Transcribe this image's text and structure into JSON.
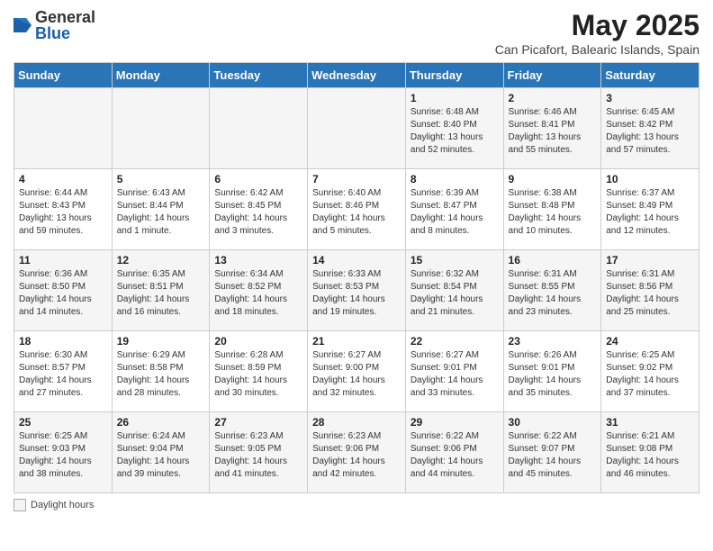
{
  "header": {
    "logo_general": "General",
    "logo_blue": "Blue",
    "main_title": "May 2025",
    "subtitle": "Can Picafort, Balearic Islands, Spain"
  },
  "days_of_week": [
    "Sunday",
    "Monday",
    "Tuesday",
    "Wednesday",
    "Thursday",
    "Friday",
    "Saturday"
  ],
  "weeks": [
    [
      {
        "day": "",
        "info": ""
      },
      {
        "day": "",
        "info": ""
      },
      {
        "day": "",
        "info": ""
      },
      {
        "day": "",
        "info": ""
      },
      {
        "day": "1",
        "info": "Sunrise: 6:48 AM\nSunset: 8:40 PM\nDaylight: 13 hours\nand 52 minutes."
      },
      {
        "day": "2",
        "info": "Sunrise: 6:46 AM\nSunset: 8:41 PM\nDaylight: 13 hours\nand 55 minutes."
      },
      {
        "day": "3",
        "info": "Sunrise: 6:45 AM\nSunset: 8:42 PM\nDaylight: 13 hours\nand 57 minutes."
      }
    ],
    [
      {
        "day": "4",
        "info": "Sunrise: 6:44 AM\nSunset: 8:43 PM\nDaylight: 13 hours\nand 59 minutes."
      },
      {
        "day": "5",
        "info": "Sunrise: 6:43 AM\nSunset: 8:44 PM\nDaylight: 14 hours\nand 1 minute."
      },
      {
        "day": "6",
        "info": "Sunrise: 6:42 AM\nSunset: 8:45 PM\nDaylight: 14 hours\nand 3 minutes."
      },
      {
        "day": "7",
        "info": "Sunrise: 6:40 AM\nSunset: 8:46 PM\nDaylight: 14 hours\nand 5 minutes."
      },
      {
        "day": "8",
        "info": "Sunrise: 6:39 AM\nSunset: 8:47 PM\nDaylight: 14 hours\nand 8 minutes."
      },
      {
        "day": "9",
        "info": "Sunrise: 6:38 AM\nSunset: 8:48 PM\nDaylight: 14 hours\nand 10 minutes."
      },
      {
        "day": "10",
        "info": "Sunrise: 6:37 AM\nSunset: 8:49 PM\nDaylight: 14 hours\nand 12 minutes."
      }
    ],
    [
      {
        "day": "11",
        "info": "Sunrise: 6:36 AM\nSunset: 8:50 PM\nDaylight: 14 hours\nand 14 minutes."
      },
      {
        "day": "12",
        "info": "Sunrise: 6:35 AM\nSunset: 8:51 PM\nDaylight: 14 hours\nand 16 minutes."
      },
      {
        "day": "13",
        "info": "Sunrise: 6:34 AM\nSunset: 8:52 PM\nDaylight: 14 hours\nand 18 minutes."
      },
      {
        "day": "14",
        "info": "Sunrise: 6:33 AM\nSunset: 8:53 PM\nDaylight: 14 hours\nand 19 minutes."
      },
      {
        "day": "15",
        "info": "Sunrise: 6:32 AM\nSunset: 8:54 PM\nDaylight: 14 hours\nand 21 minutes."
      },
      {
        "day": "16",
        "info": "Sunrise: 6:31 AM\nSunset: 8:55 PM\nDaylight: 14 hours\nand 23 minutes."
      },
      {
        "day": "17",
        "info": "Sunrise: 6:31 AM\nSunset: 8:56 PM\nDaylight: 14 hours\nand 25 minutes."
      }
    ],
    [
      {
        "day": "18",
        "info": "Sunrise: 6:30 AM\nSunset: 8:57 PM\nDaylight: 14 hours\nand 27 minutes."
      },
      {
        "day": "19",
        "info": "Sunrise: 6:29 AM\nSunset: 8:58 PM\nDaylight: 14 hours\nand 28 minutes."
      },
      {
        "day": "20",
        "info": "Sunrise: 6:28 AM\nSunset: 8:59 PM\nDaylight: 14 hours\nand 30 minutes."
      },
      {
        "day": "21",
        "info": "Sunrise: 6:27 AM\nSunset: 9:00 PM\nDaylight: 14 hours\nand 32 minutes."
      },
      {
        "day": "22",
        "info": "Sunrise: 6:27 AM\nSunset: 9:01 PM\nDaylight: 14 hours\nand 33 minutes."
      },
      {
        "day": "23",
        "info": "Sunrise: 6:26 AM\nSunset: 9:01 PM\nDaylight: 14 hours\nand 35 minutes."
      },
      {
        "day": "24",
        "info": "Sunrise: 6:25 AM\nSunset: 9:02 PM\nDaylight: 14 hours\nand 37 minutes."
      }
    ],
    [
      {
        "day": "25",
        "info": "Sunrise: 6:25 AM\nSunset: 9:03 PM\nDaylight: 14 hours\nand 38 minutes."
      },
      {
        "day": "26",
        "info": "Sunrise: 6:24 AM\nSunset: 9:04 PM\nDaylight: 14 hours\nand 39 minutes."
      },
      {
        "day": "27",
        "info": "Sunrise: 6:23 AM\nSunset: 9:05 PM\nDaylight: 14 hours\nand 41 minutes."
      },
      {
        "day": "28",
        "info": "Sunrise: 6:23 AM\nSunset: 9:06 PM\nDaylight: 14 hours\nand 42 minutes."
      },
      {
        "day": "29",
        "info": "Sunrise: 6:22 AM\nSunset: 9:06 PM\nDaylight: 14 hours\nand 44 minutes."
      },
      {
        "day": "30",
        "info": "Sunrise: 6:22 AM\nSunset: 9:07 PM\nDaylight: 14 hours\nand 45 minutes."
      },
      {
        "day": "31",
        "info": "Sunrise: 6:21 AM\nSunset: 9:08 PM\nDaylight: 14 hours\nand 46 minutes."
      }
    ]
  ],
  "footer": {
    "legend_label": "Daylight hours"
  }
}
